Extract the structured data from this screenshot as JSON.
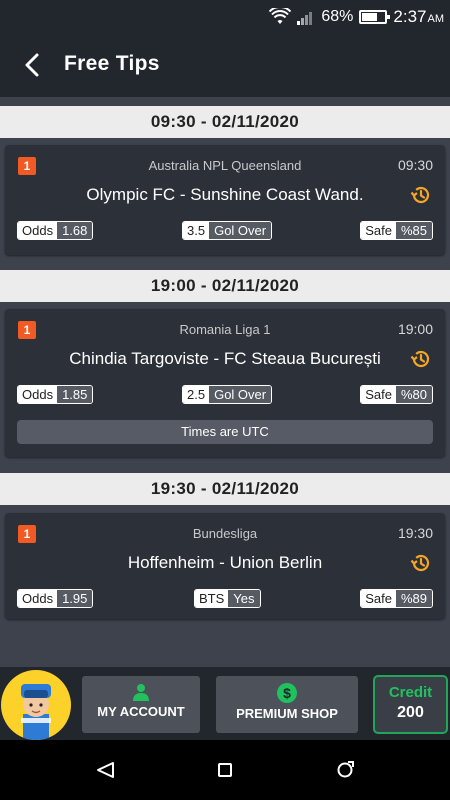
{
  "status_bar": {
    "battery": "68%",
    "battery_level": 0.68,
    "time": "2:37",
    "ampm": "AM",
    "icons": [
      "wifi-icon",
      "signal-icon",
      "battery-icon"
    ]
  },
  "app_bar": {
    "title": "Free Tips",
    "back_icon": "chevron-left-icon"
  },
  "sections": [
    {
      "date": "09:30 - 02/11/2020",
      "card": {
        "badge": "1",
        "league": "Australia NPL Queensland",
        "time": "09:30",
        "match": "Olympic FC - Sunshine Coast Wand.",
        "odds_label": "Odds",
        "odds_value": "1.68",
        "tip_label": "3.5",
        "tip_value": "Gol Over",
        "safe_label": "Safe",
        "safe_value": "%85"
      }
    },
    {
      "date": "19:00 - 02/11/2020",
      "card": {
        "badge": "1",
        "league": "Romania Liga 1",
        "time": "19:00",
        "match": "Chindia Targoviste - FC Steaua București",
        "odds_label": "Odds",
        "odds_value": "1.85",
        "tip_label": "2.5",
        "tip_value": "Gol Over",
        "safe_label": "Safe",
        "safe_value": "%80",
        "note": "Times are UTC"
      }
    },
    {
      "date": "19:30 - 02/11/2020",
      "card": {
        "badge": "1",
        "league": "Bundesliga",
        "time": "19:30",
        "match": "Hoffenheim - Union Berlin",
        "odds_label": "Odds",
        "odds_value": "1.95",
        "tip_label": "BTS",
        "tip_value": "Yes",
        "safe_label": "Safe",
        "safe_value": "%89"
      }
    }
  ],
  "bottom_bar": {
    "account_label": "MY ACCOUNT",
    "shop_label": "PREMIUM SHOP",
    "credit_label": "Credit",
    "credit_value": "200"
  },
  "colors": {
    "background": "#3d424c",
    "card": "#2c3038",
    "badge": "#f15a22",
    "history_icon": "#f5a623",
    "credit_accent": "#20c25e"
  }
}
